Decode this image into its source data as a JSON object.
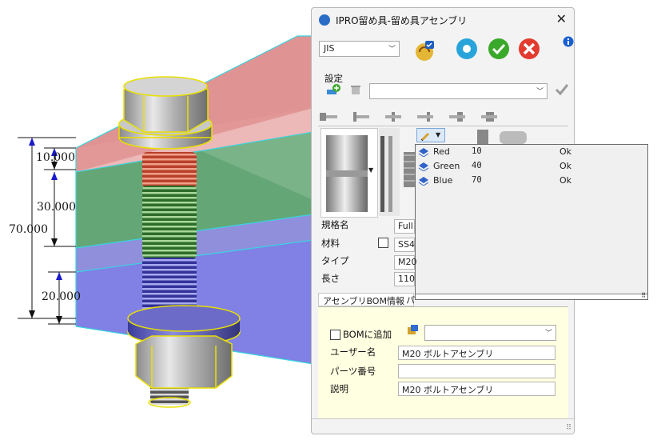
{
  "dimensions": {
    "d1": "10.000",
    "d2": "30.000",
    "d3": "70.000",
    "d4": "20.000"
  },
  "dialog": {
    "title": "IPRO留め具-留め具アセンブリ",
    "standard_select": "JIS",
    "settings_label": "設定",
    "settings_combo": "",
    "popup_rows": [
      {
        "name": "Red",
        "value": "10",
        "status": "Ok"
      },
      {
        "name": "Green",
        "value": "40",
        "status": "Ok"
      },
      {
        "name": "Blue",
        "value": "70",
        "status": "Ok"
      }
    ],
    "props": {
      "spec_label": "規格名",
      "spec_value": "Full",
      "material_label": "材料",
      "material_value": "SS4",
      "type_label": "タイプ",
      "type_value": "M20",
      "length_label": "長さ",
      "length_value": "110"
    },
    "bottom_tab_1": "アセンブリBOM情報",
    "bottom_tab_2": "パ",
    "bom": {
      "add_label": "BOMに追加",
      "bom_combo": "",
      "user_name_label": "ユーザー名",
      "user_name_value": "M20 ボルトアセンブリ",
      "part_number_label": "パーツ番号",
      "part_number_value": "",
      "description_label": "説明",
      "description_value": "M20 ボルトアセンブリ"
    }
  }
}
